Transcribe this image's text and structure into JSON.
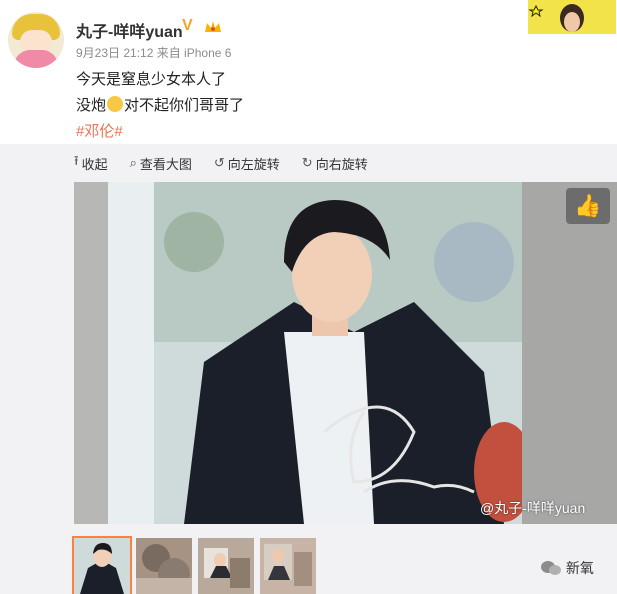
{
  "header": {
    "username": "丸子-咩咩yuan",
    "verified_badge": "V",
    "meta_text": "9月23日 21:12 来自 iPhone 6"
  },
  "post": {
    "line1": "今天是窒息少女本人了",
    "line2_before_emoji": "没炮",
    "line2_after_emoji": "对不起你们哥哥了",
    "hashtag": "#邓伦#"
  },
  "toolbar": {
    "items": [
      {
        "icon": "arrow-up-icon",
        "glyph": "⭱",
        "label": "收起"
      },
      {
        "icon": "search-icon",
        "glyph": "⌕",
        "label": "查看大图"
      },
      {
        "icon": "rotate-left-icon",
        "glyph": "↺",
        "label": "向左旋转"
      },
      {
        "icon": "rotate-right-icon",
        "glyph": "↻",
        "label": "向右旋转"
      }
    ]
  },
  "photo": {
    "watermark": "@丸子-咩咩yuan",
    "like_icon": "thumbs-up-icon"
  },
  "thumbnails": [
    "thumb-1",
    "thumb-2",
    "thumb-3",
    "thumb-4"
  ],
  "footer": {
    "wechat_label": "新氧"
  },
  "colors": {
    "hashtag": "#eb7350",
    "verified": "#f5a623",
    "active_thumb": "#ff8140"
  }
}
